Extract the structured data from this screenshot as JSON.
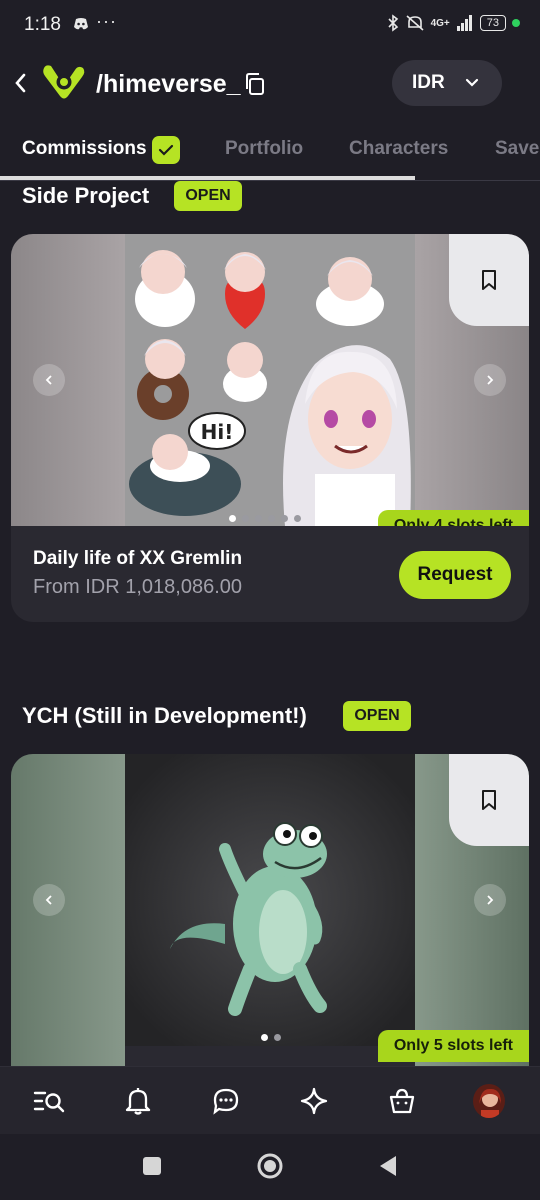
{
  "status_bar": {
    "time": "1:18",
    "dots": "···",
    "network": "4G+",
    "battery": "73"
  },
  "header": {
    "username": "/himeverse_",
    "currency": "IDR"
  },
  "tabs": [
    {
      "label": "Commissions",
      "active": true
    },
    {
      "label": "Portfolio",
      "active": false
    },
    {
      "label": "Characters",
      "active": false
    },
    {
      "label": "Save",
      "active": false
    }
  ],
  "sections": [
    {
      "title": "Side Project",
      "badge": "OPEN",
      "card": {
        "slots": "Only 4 slots left",
        "title": "Daily life of XX Gremlin",
        "price": "From IDR 1,018,086.00",
        "button": "Request",
        "sticker_text": "Hi!"
      }
    },
    {
      "title": "YCH (Still in Development!)",
      "badge": "OPEN",
      "card": {
        "slots": "Only 5 slots left"
      }
    }
  ],
  "bottom_nav": [
    "search-list-icon",
    "bell-icon",
    "chat-icon",
    "sparkle-icon",
    "shopping-bag-icon",
    "profile-avatar"
  ],
  "colors": {
    "background": "#1f1e26",
    "card": "#2a2931",
    "accent": "#b6e324"
  }
}
